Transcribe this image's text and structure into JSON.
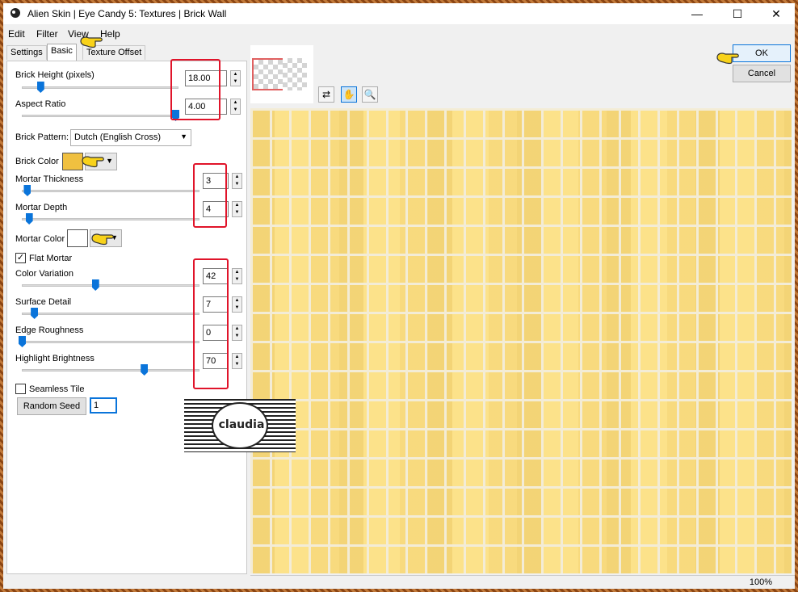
{
  "window": {
    "title": "Alien Skin | Eye Candy 5: Textures | Brick Wall",
    "minimize": "—",
    "maximize": "☐",
    "close": "✕"
  },
  "menu": [
    "Edit",
    "Filter",
    "View",
    "Help"
  ],
  "tabs": [
    "Settings",
    "Basic",
    "Texture Offset"
  ],
  "active_tab": "Basic",
  "controls": {
    "brick_height": {
      "label": "Brick Height (pixels)",
      "value": "18.00",
      "slider_fraction": 0.12
    },
    "aspect_ratio": {
      "label": "Aspect Ratio",
      "value": "4.00",
      "slider_fraction": 1.0
    },
    "brick_pattern": {
      "label": "Brick Pattern:",
      "value": "Dutch (English Cross)"
    },
    "brick_color": {
      "label": "Brick Color",
      "color": "#f0c040"
    },
    "mortar_thickness": {
      "label": "Mortar Thickness",
      "value": "3",
      "slider_fraction": 0.03
    },
    "mortar_depth": {
      "label": "Mortar Depth",
      "value": "4",
      "slider_fraction": 0.04
    },
    "mortar_color": {
      "label": "Mortar Color",
      "color": "#ffffff"
    },
    "flat_mortar": {
      "label": "Flat Mortar",
      "checked": true,
      "mark": "✓"
    },
    "color_variation": {
      "label": "Color Variation",
      "value": "42",
      "slider_fraction": 0.42
    },
    "surface_detail": {
      "label": "Surface Detail",
      "value": "7",
      "slider_fraction": 0.07
    },
    "edge_roughness": {
      "label": "Edge Roughness",
      "value": "0",
      "slider_fraction": 0.0
    },
    "highlight_brightness": {
      "label": "Highlight Brightness",
      "value": "70",
      "slider_fraction": 0.7
    },
    "seamless_tile": {
      "label": "Seamless Tile",
      "checked": false
    },
    "random_seed": {
      "label": "Random Seed",
      "value": "1"
    }
  },
  "buttons": {
    "ok": "OK",
    "cancel": "Cancel"
  },
  "zoom": "100%",
  "watermark": "claudia",
  "colors": {
    "brick": "#fbe08a",
    "mortar": "#f3ecd6",
    "slider": "#0a74da",
    "highlight": "#e0142a"
  }
}
